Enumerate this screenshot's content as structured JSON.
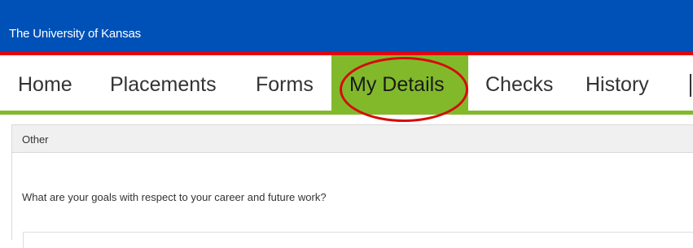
{
  "header": {
    "title": "The University of Kansas",
    "background_color": "#0051b7",
    "rule_color": "#e8000b"
  },
  "nav": {
    "accent_color": "#82b92b",
    "items": [
      {
        "label": "Home",
        "active": false
      },
      {
        "label": "Placements",
        "active": false
      },
      {
        "label": "Forms",
        "active": false
      },
      {
        "label": "My Details",
        "active": true,
        "highlighted": true
      },
      {
        "label": "Checks",
        "active": false
      },
      {
        "label": "History",
        "active": false
      }
    ],
    "highlight_color": "#d60a0a"
  },
  "panel": {
    "header_label": "Other",
    "question": "What are your goals with respect to your career and future work?",
    "answer_value": ""
  }
}
